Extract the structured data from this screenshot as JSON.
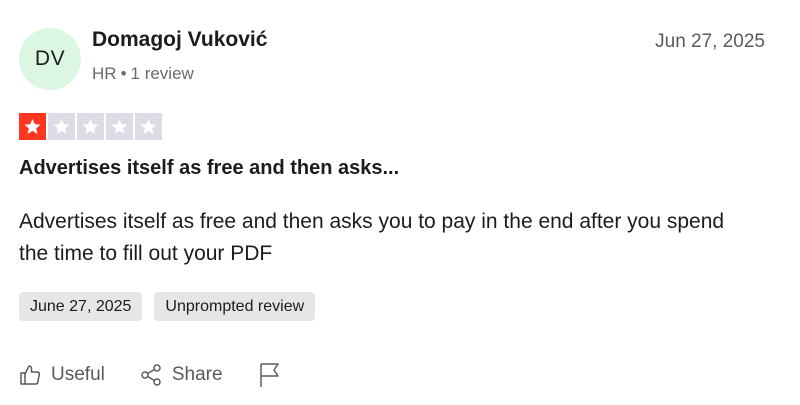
{
  "reviewer": {
    "initials": "DV",
    "name": "Domagoj Vuković",
    "country": "HR",
    "separator": "•",
    "review_count": "1 review",
    "avatar_color": "#dcf7e1"
  },
  "review": {
    "date": "Jun 27, 2025",
    "rating": 1,
    "max_rating": 5,
    "filled_star_color": "#ff3722",
    "empty_star_color": "#dcdce6",
    "title": "Advertises itself as free and then asks...",
    "body": "Advertises itself as free and then asks you to pay in the end after you spend the time to fill out your PDF",
    "tags": [
      "June 27, 2025",
      "Unprompted review"
    ]
  },
  "actions": {
    "useful_label": "Useful",
    "share_label": "Share",
    "useful_icon": "thumbs-up-icon",
    "share_icon": "share-icon",
    "flag_icon": "flag-icon"
  }
}
